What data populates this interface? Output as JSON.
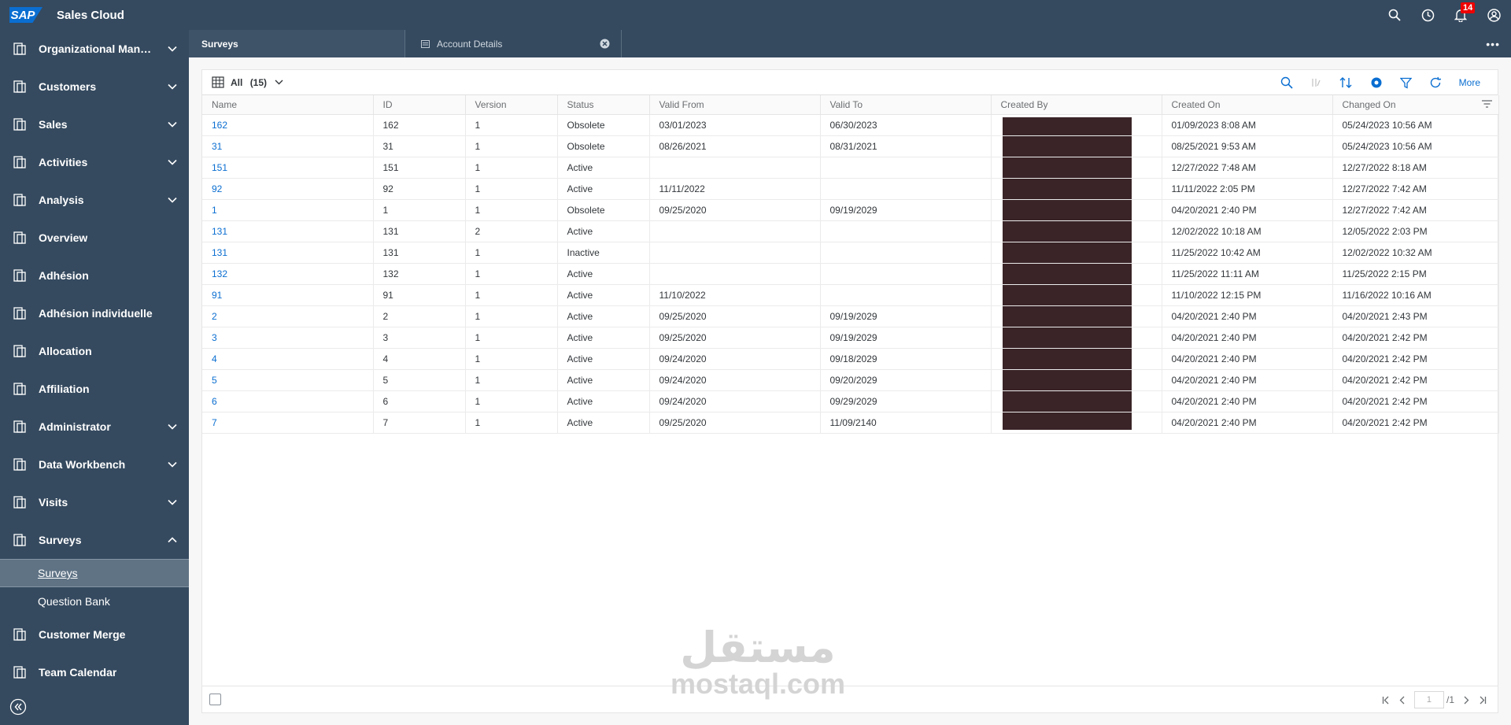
{
  "shell": {
    "logo": "SAP",
    "title": "Sales Cloud",
    "notification_count": "14"
  },
  "sidebar": {
    "items": [
      {
        "label": "Organizational Manag...",
        "icon": "org-icon",
        "expandable": true
      },
      {
        "label": "Customers",
        "icon": "customers-icon",
        "expandable": true
      },
      {
        "label": "Sales",
        "icon": "sales-icon",
        "expandable": true
      },
      {
        "label": "Activities",
        "icon": "activities-icon",
        "expandable": true
      },
      {
        "label": "Analysis",
        "icon": "analysis-icon",
        "expandable": true
      },
      {
        "label": "Overview",
        "icon": "overview-icon",
        "expandable": false
      },
      {
        "label": "Adhésion",
        "icon": "adhesion-icon",
        "expandable": false
      },
      {
        "label": "Adhésion individuelle",
        "icon": "adhesion-individuelle-icon",
        "expandable": false
      },
      {
        "label": "Allocation",
        "icon": "allocation-icon",
        "expandable": false
      },
      {
        "label": "Affiliation",
        "icon": "affiliation-icon",
        "expandable": false
      },
      {
        "label": "Administrator",
        "icon": "administrator-icon",
        "expandable": true
      },
      {
        "label": "Data Workbench",
        "icon": "data-workbench-icon",
        "expandable": true
      },
      {
        "label": "Visits",
        "icon": "visits-icon",
        "expandable": true
      },
      {
        "label": "Surveys",
        "icon": "surveys-icon",
        "expandable": true,
        "expanded": true
      }
    ],
    "sub_items": [
      {
        "label": "Surveys",
        "active": true
      },
      {
        "label": "Question Bank",
        "active": false
      }
    ],
    "bottom_items": [
      {
        "label": "Customer Merge",
        "icon": "customer-merge-icon"
      },
      {
        "label": "Team Calendar",
        "icon": "team-calendar-icon"
      }
    ]
  },
  "tabs": [
    {
      "label": "Surveys",
      "active": true
    },
    {
      "label": "Account Details",
      "active": false
    }
  ],
  "toolbar": {
    "view_label": "All",
    "view_count": "(15)",
    "more_label": "More"
  },
  "table": {
    "columns": [
      "Name",
      "ID",
      "Version",
      "Status",
      "Valid From",
      "Valid To",
      "Created By",
      "Created On",
      "Changed On"
    ],
    "rows": [
      [
        "162",
        "162",
        "1",
        "Obsolete",
        "03/01/2023",
        "06/30/2023",
        "",
        "01/09/2023 8:08 AM",
        "05/24/2023 10:56 AM"
      ],
      [
        "31",
        "31",
        "1",
        "Obsolete",
        "08/26/2021",
        "08/31/2021",
        "",
        "08/25/2021 9:53 AM",
        "05/24/2023 10:56 AM"
      ],
      [
        "151",
        "151",
        "1",
        "Active",
        "",
        "",
        "",
        "12/27/2022 7:48 AM",
        "12/27/2022 8:18 AM"
      ],
      [
        "92",
        "92",
        "1",
        "Active",
        "11/11/2022",
        "",
        "",
        "11/11/2022 2:05 PM",
        "12/27/2022 7:42 AM"
      ],
      [
        "1",
        "1",
        "1",
        "Obsolete",
        "09/25/2020",
        "09/19/2029",
        "",
        "04/20/2021 2:40 PM",
        "12/27/2022 7:42 AM"
      ],
      [
        "131",
        "131",
        "2",
        "Active",
        "",
        "",
        "",
        "12/02/2022 10:18 AM",
        "12/05/2022 2:03 PM"
      ],
      [
        "131",
        "131",
        "1",
        "Inactive",
        "",
        "",
        "",
        "11/25/2022 10:42 AM",
        "12/02/2022 10:32 AM"
      ],
      [
        "132",
        "132",
        "1",
        "Active",
        "",
        "",
        "",
        "11/25/2022 11:11 AM",
        "11/25/2022 2:15 PM"
      ],
      [
        "91",
        "91",
        "1",
        "Active",
        "11/10/2022",
        "",
        "",
        "11/10/2022 12:15 PM",
        "11/16/2022 10:16 AM"
      ],
      [
        "2",
        "2",
        "1",
        "Active",
        "09/25/2020",
        "09/19/2029",
        "",
        "04/20/2021 2:40 PM",
        "04/20/2021 2:43 PM"
      ],
      [
        "3",
        "3",
        "1",
        "Active",
        "09/25/2020",
        "09/19/2029",
        "",
        "04/20/2021 2:40 PM",
        "04/20/2021 2:42 PM"
      ],
      [
        "4",
        "4",
        "1",
        "Active",
        "09/24/2020",
        "09/18/2029",
        "",
        "04/20/2021 2:40 PM",
        "04/20/2021 2:42 PM"
      ],
      [
        "5",
        "5",
        "1",
        "Active",
        "09/24/2020",
        "09/20/2029",
        "",
        "04/20/2021 2:40 PM",
        "04/20/2021 2:42 PM"
      ],
      [
        "6",
        "6",
        "1",
        "Active",
        "09/24/2020",
        "09/29/2029",
        "",
        "04/20/2021 2:40 PM",
        "04/20/2021 2:42 PM"
      ],
      [
        "7",
        "7",
        "1",
        "Active",
        "09/25/2020",
        "11/09/2140",
        "",
        "04/20/2021 2:40 PM",
        "04/20/2021 2:42 PM"
      ]
    ]
  },
  "pager": {
    "current_page": "1",
    "total_pages": "/1"
  },
  "watermark": {
    "arabic": "مستقل",
    "latin": "mostaql.com"
  },
  "colors": {
    "shell_bg": "#354a5f",
    "link": "#0a6ed1",
    "redaction": "#3a2428",
    "badge": "#e00000"
  }
}
